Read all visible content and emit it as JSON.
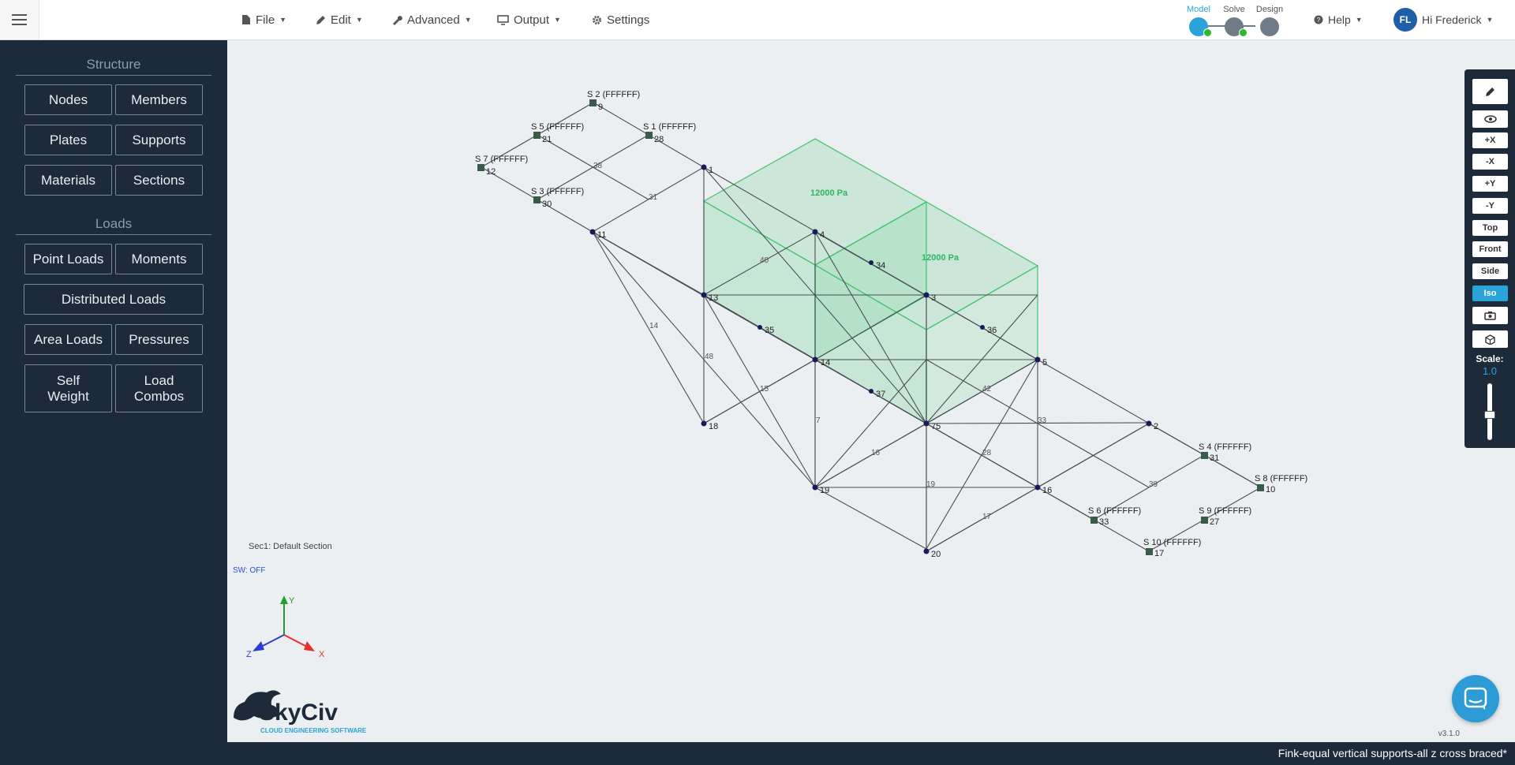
{
  "topbar": {
    "menus": [
      {
        "label": "File",
        "icon": "file-icon"
      },
      {
        "label": "Edit",
        "icon": "pencil-icon"
      },
      {
        "label": "Advanced",
        "icon": "wrench-icon"
      },
      {
        "label": "Output",
        "icon": "monitor-icon"
      },
      {
        "label": "Settings",
        "icon": "gear-icon"
      }
    ],
    "steps": [
      {
        "label": "Model",
        "active": true
      },
      {
        "label": "Solve",
        "active": false
      },
      {
        "label": "Design",
        "active": false
      }
    ],
    "help": "Help",
    "user": {
      "initials": "FL",
      "greeting": "Hi Frederick"
    }
  },
  "sidebar": {
    "structure_heading": "Structure",
    "structure_buttons": [
      "Nodes",
      "Members",
      "Plates",
      "Supports",
      "Materials",
      "Sections"
    ],
    "loads_heading": "Loads",
    "load_buttons": [
      "Point Loads",
      "Moments",
      "Distributed Loads",
      "Area Loads",
      "Pressures",
      "Self\nWeight",
      "Load\nCombos"
    ]
  },
  "viewport": {
    "section_info": "Sec1: Default Section",
    "self_weight": "SW: OFF",
    "axes": {
      "x": "X",
      "y": "Y",
      "z": "Z"
    },
    "pressure_labels": [
      "12000 Pa",
      "12000 Pa"
    ],
    "support_labels": [
      "S 2 (FFFFFF)",
      "S 5 (FFFFFF)",
      "S 1 (FFFFFF)",
      "S 7 (FFFFFF)",
      "S 3 (FFFFFF)",
      "S 4 (FFFFFF)",
      "S 8 (FFFFFF)",
      "S 6 (FFFFFF)",
      "S 9 (FFFFFF)",
      "S 10 (FFFFFF)"
    ],
    "node_labels": [
      "9",
      "21",
      "28",
      "12",
      "30",
      "1",
      "11",
      "4",
      "34",
      "3",
      "13",
      "35",
      "36",
      "5",
      "18",
      "37",
      "2",
      "19",
      "20",
      "31",
      "10",
      "33",
      "27",
      "17",
      "14",
      "75",
      "16"
    ],
    "member_labels": [
      "38",
      "31",
      "14",
      "48",
      "15",
      "7",
      "16",
      "19",
      "17",
      "28",
      "39",
      "40",
      "42",
      "33"
    ]
  },
  "right_toolbar": {
    "buttons": [
      "+X",
      "-X",
      "+Y",
      "-Y",
      "Top",
      "Front",
      "Side",
      "Iso"
    ],
    "active": "Iso",
    "scale_label": "Scale:",
    "scale_value": "1.0"
  },
  "logo": {
    "name": "SkyCiv",
    "tagline": "CLOUD ENGINEERING SOFTWARE"
  },
  "version": "v3.1.0",
  "model_name": "Fink-equal vertical supports-all z cross braced*",
  "colors": {
    "sidebar": "#1d2a3a",
    "accent": "#2aa3d9",
    "pressure": "#3ec46d",
    "support": "#3a5a4a"
  }
}
